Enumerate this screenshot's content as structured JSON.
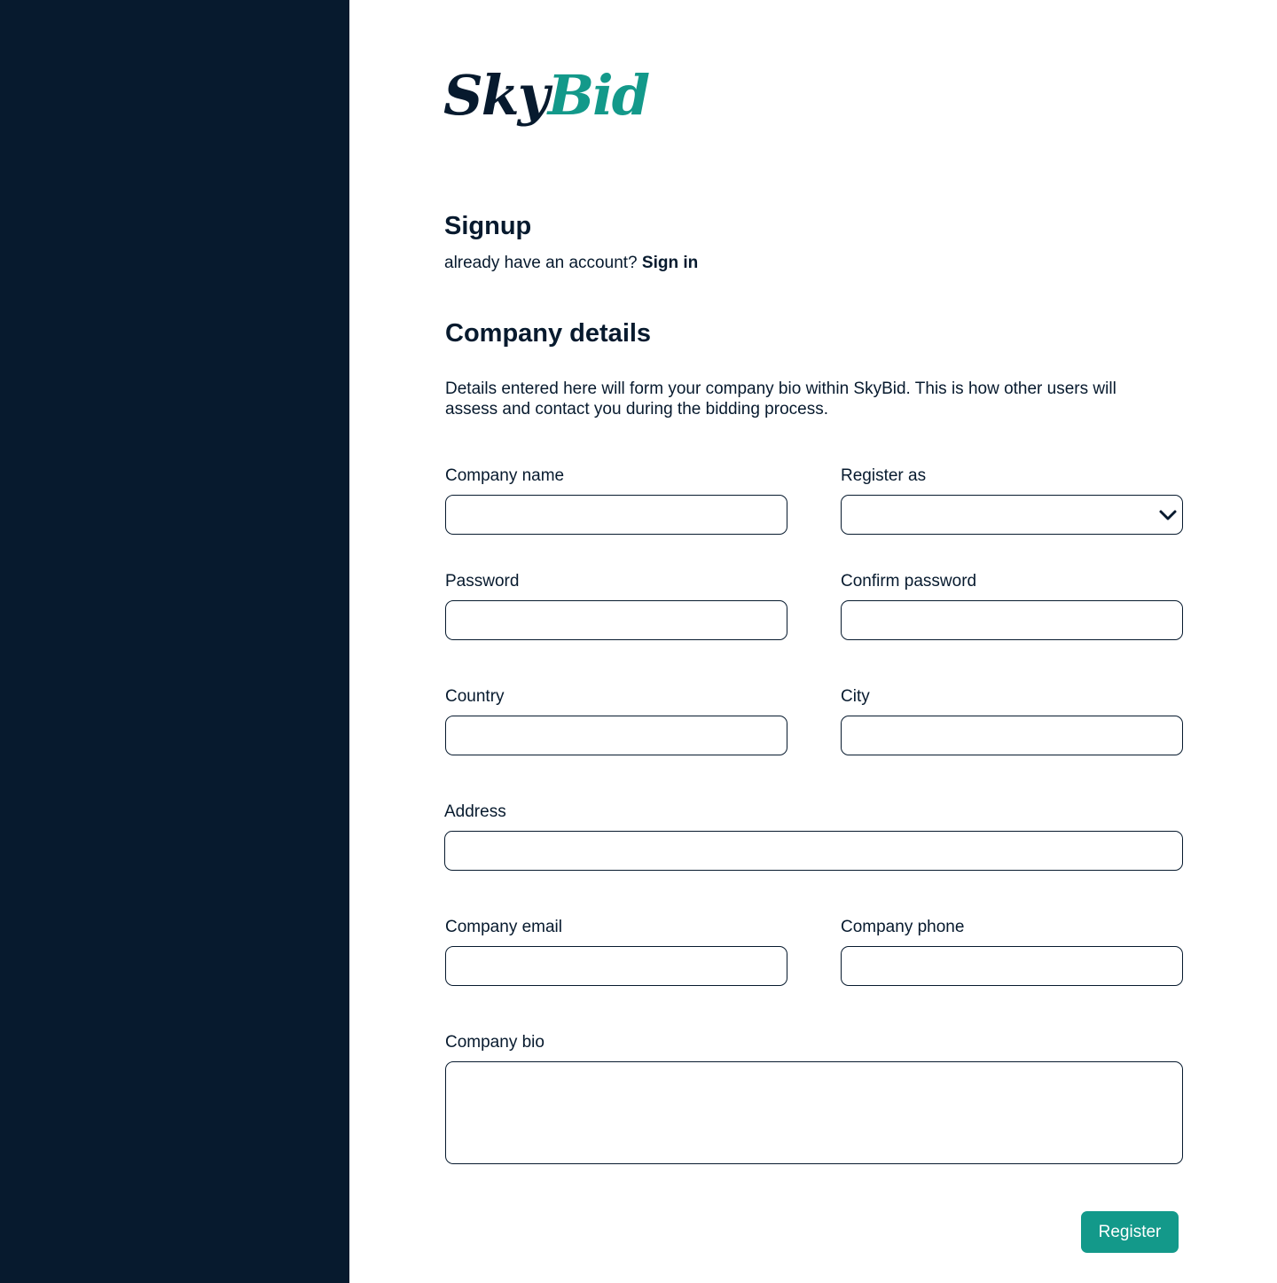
{
  "brand": {
    "part1": "Sky",
    "part2": "Bid"
  },
  "header": {
    "title": "Signup",
    "signin_prompt": "already have an account?",
    "signin_link": "Sign in"
  },
  "section": {
    "title": "Company details",
    "description": "Details entered here will form your company bio within SkyBid. This is how other users will assess and contact you during the bidding process."
  },
  "form": {
    "company_name": {
      "label": "Company name",
      "value": ""
    },
    "register_as": {
      "label": "Register as",
      "value": ""
    },
    "password": {
      "label": "Password",
      "value": ""
    },
    "confirm_password": {
      "label": "Confirm password",
      "value": ""
    },
    "country": {
      "label": "Country",
      "value": ""
    },
    "city": {
      "label": "City",
      "value": ""
    },
    "address": {
      "label": "Address",
      "value": ""
    },
    "company_email": {
      "label": "Company email",
      "value": ""
    },
    "company_phone": {
      "label": "Company phone",
      "value": ""
    },
    "company_bio": {
      "label": "Company bio",
      "value": ""
    }
  },
  "actions": {
    "register_label": "Register"
  },
  "colors": {
    "navy": "#071a2e",
    "teal": "#13998a",
    "background": "#ffffff"
  },
  "icons": {
    "select_arrow": "chevron-down-icon"
  }
}
